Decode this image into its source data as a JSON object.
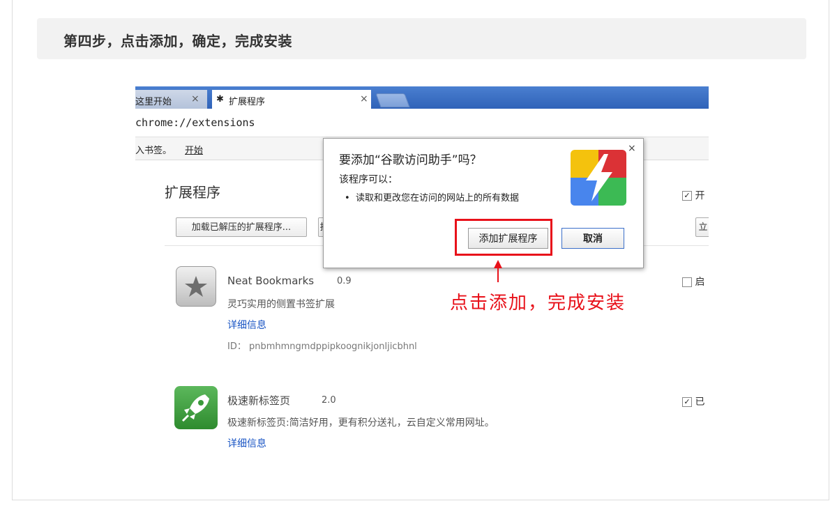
{
  "step": {
    "title": "第四步，点击添加，确定，完成安装"
  },
  "browser": {
    "tabs": [
      {
        "label": "这里开始"
      },
      {
        "label": "扩展程序"
      }
    ],
    "url": "chrome://extensions",
    "bookmarks": {
      "text": "入书签。",
      "link": "开始"
    }
  },
  "extensions_page": {
    "title": "扩展程序",
    "load_button": "加载已解压的扩展程序...",
    "pack_button": "打",
    "update_button": "立",
    "dev_mode_label": "开",
    "items": [
      {
        "name": "Neat Bookmarks",
        "version": "0.9",
        "description": "灵巧实用的侧置书签扩展",
        "details_link": "详细信息",
        "id": "ID： pnbmhmngmdppipkoognikjonljicbhnl",
        "enable_label": "启"
      },
      {
        "name": "极速新标签页",
        "version": "2.0",
        "description": "极速新标签页:简洁好用，更有积分送礼，云自定义常用网址。",
        "details_link": "详细信息",
        "enable_label": "已"
      }
    ]
  },
  "dialog": {
    "title": "要添加“谷歌访问助手”吗？",
    "subtitle": "该程序可以：",
    "permission": "读取和更改您在访问的网站上的所有数据",
    "add_button": "添加扩展程序",
    "cancel_button": "取消",
    "close_glyph": "×"
  },
  "annotation": {
    "text": "点击添加，完成安装",
    "color": "#e8111a"
  }
}
